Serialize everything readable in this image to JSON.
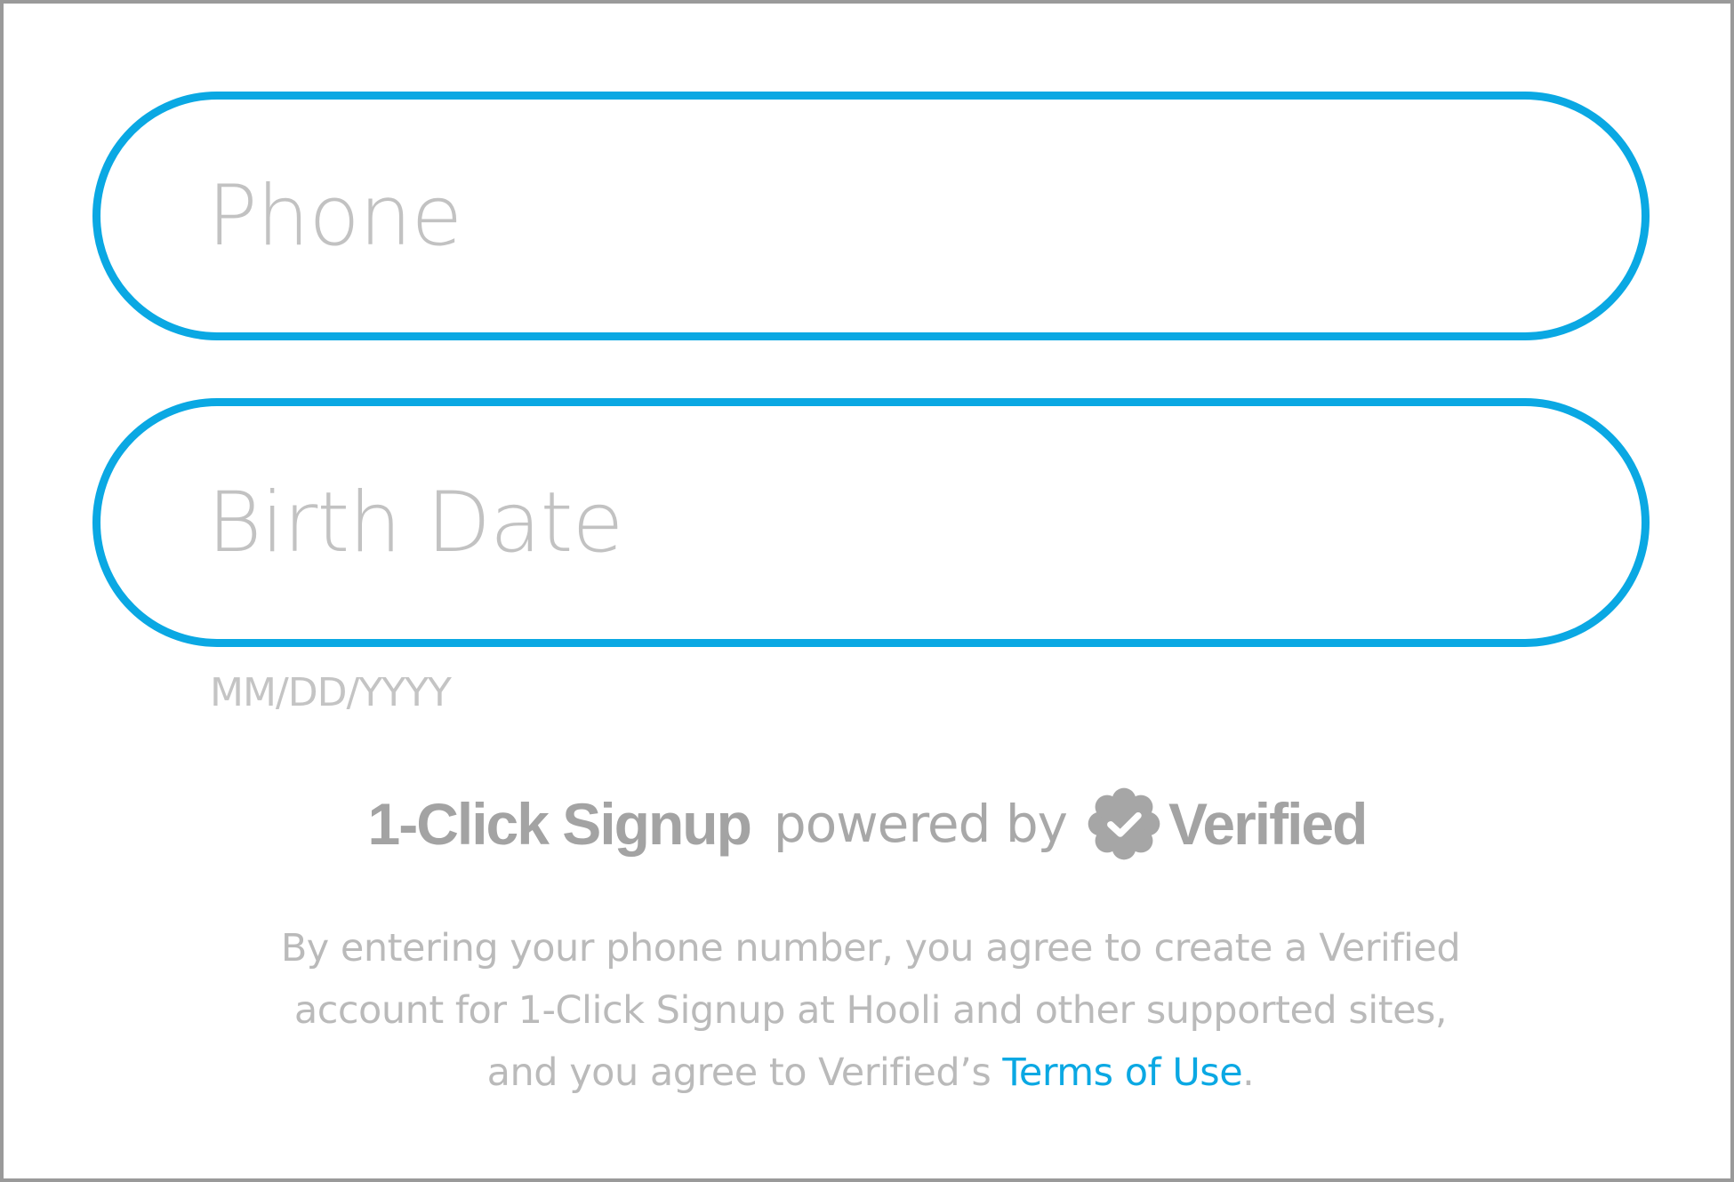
{
  "form": {
    "phone": {
      "placeholder": "Phone",
      "value": ""
    },
    "birth_date": {
      "placeholder": "Birth Date",
      "value": "",
      "hint": "MM/DD/YYYY"
    }
  },
  "powered_by": {
    "brand": "1-Click Signup",
    "connector": "powered by",
    "badge_icon": "verified-badge-icon",
    "provider": "Verified"
  },
  "legal": {
    "line1": "By entering your phone number, you agree to create a Verified",
    "line2": "account for 1-Click Signup at Hooli and other supported sites,",
    "line3_prefix": "and you agree to Verified’s",
    "terms_link": "Terms of Use",
    "line3_suffix": "."
  },
  "colors": {
    "accent": "#0aa8e3",
    "frame_border": "#9a9a9a",
    "muted_text": "#bababa",
    "brand_text": "#a3a3a3"
  }
}
